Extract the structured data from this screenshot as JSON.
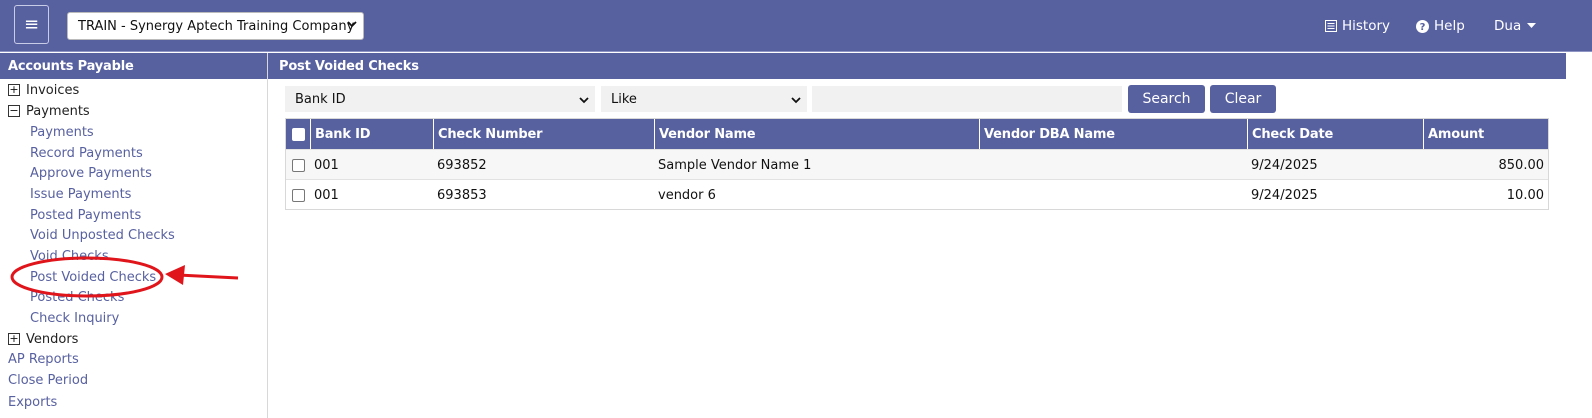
{
  "header": {
    "menu_icon": "hamburger-icon",
    "company": "TRAIN - Synergy Aptech Training Company",
    "history_label": "History",
    "help_label": "Help",
    "user_label": "Dua"
  },
  "sidebar": {
    "title": "Accounts Payable",
    "invoices": "Invoices",
    "payments": "Payments",
    "payment_items": [
      "Payments",
      "Record Payments",
      "Approve Payments",
      "Issue Payments",
      "Posted Payments",
      "Void Unposted Checks",
      "Void Checks",
      "Post Voided Checks",
      "Posted Checks",
      "Check Inquiry"
    ],
    "vendors": "Vendors",
    "ap_reports": "AP Reports",
    "close_period": "Close Period",
    "exports": "Exports"
  },
  "main": {
    "title": "Post Voided Checks",
    "filter": {
      "field_value": "Bank ID",
      "operator_value": "Like",
      "search_value": "",
      "search_label": "Search",
      "clear_label": "Clear"
    },
    "columns": [
      "Bank ID",
      "Check Number",
      "Vendor Name",
      "Vendor DBA Name",
      "Check Date",
      "Amount"
    ],
    "rows": [
      {
        "bank_id": "001",
        "check_number": "693852",
        "vendor_name": "Sample Vendor Name 1",
        "vendor_dba": "",
        "check_date": "9/24/2025",
        "amount": "850.00"
      },
      {
        "bank_id": "001",
        "check_number": "693853",
        "vendor_name": "vendor 6",
        "vendor_dba": "",
        "check_date": "9/24/2025",
        "amount": "10.00"
      }
    ]
  },
  "colors": {
    "brand": "#5861a0",
    "annotation": "#e0151b"
  }
}
